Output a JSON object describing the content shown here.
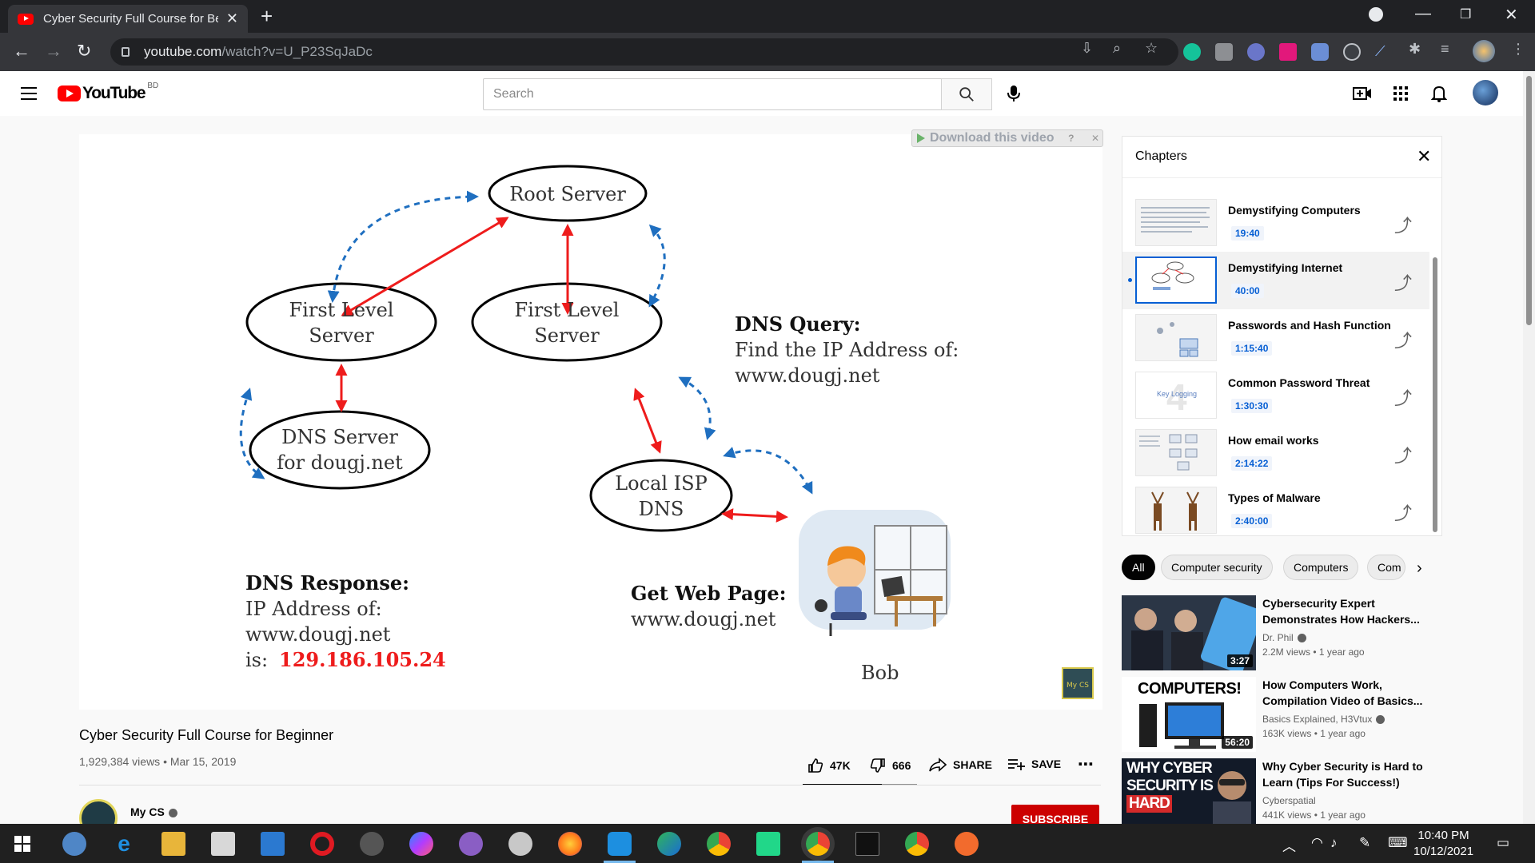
{
  "browser": {
    "tab_title": "Cyber Security Full Course for Be",
    "url_host": "youtube.com",
    "url_rest": "/watch?v=U_P23SqJaDc"
  },
  "youtube": {
    "logo_text": "YouTube",
    "country_code": "BD",
    "search_placeholder": "Search"
  },
  "video": {
    "download_label": "Download this video",
    "download_extra": "?",
    "title": "Cyber Security Full Course for Beginner",
    "meta": "1,929,384 views • Mar 15, 2019",
    "likes": "47K",
    "dislikes": "666",
    "share_label": "SHARE",
    "save_label": "SAVE",
    "like_ratio": 0.69,
    "channel": "My CS",
    "subscribe_label": "SUBSCRIBE"
  },
  "diagram": {
    "root": "Root Server",
    "first_level_1_line1": "First Level",
    "first_level_1_line2": "Server",
    "first_level_2_line1": "First Level",
    "first_level_2_line2": "Server",
    "dns_server_line1": "DNS Server",
    "dns_server_line2": "for dougj.net",
    "local_isp_line1": "Local ISP",
    "local_isp_line2": "DNS",
    "query_title": "DNS Query:",
    "query_line1": "Find the IP Address of:",
    "query_line2": "www.dougj.net",
    "response_title": "DNS Response:",
    "response_line1": "IP Address of:",
    "response_line2": "www.dougj.net",
    "response_is": "is:",
    "response_ip": "129.186.105.24",
    "webpage_title": "Get Web Page:",
    "webpage_line": "www.dougj.net",
    "user": "Bob",
    "watermark": "My CS"
  },
  "chapters": {
    "title": "Chapters",
    "items": [
      {
        "name": "Demystifying Computers",
        "time": "19:40"
      },
      {
        "name": "Demystifying Internet",
        "time": "40:00"
      },
      {
        "name": "Passwords and Hash Function",
        "time": "1:15:40"
      },
      {
        "name": "Common Password Threat",
        "time": "1:30:30"
      },
      {
        "name": "How email works",
        "time": "2:14:22"
      },
      {
        "name": "Types of Malware",
        "time": "2:40:00"
      }
    ],
    "thumb_text": "Key Logging"
  },
  "chips": [
    "All",
    "Computer security",
    "Computers",
    "Com"
  ],
  "recommendations": [
    {
      "title": "Cybersecurity Expert Demonstrates How Hackers...",
      "channel": "Dr. Phil",
      "views": "2.2M views • 1 year ago",
      "duration": "3:27",
      "thumb_text": ""
    },
    {
      "title": "How Computers Work, Compilation Video of Basics...",
      "channel": "Basics Explained, H3Vtux",
      "views": "163K views • 1 year ago",
      "duration": "56:20",
      "thumb_text": "COMPUTERS!"
    },
    {
      "title": "Why Cyber Security is Hard to Learn (Tips For Success!)",
      "channel": "Cyberspatial",
      "views": "441K views • 1 year ago",
      "duration": "",
      "thumb_text_1": "WHY CYBER",
      "thumb_text_2": "SECURITY IS",
      "thumb_text_3": "HARD"
    }
  ],
  "taskbar": {
    "time": "10:40 PM",
    "date": "10/12/2021"
  },
  "colors": {
    "youtube_red": "#ff0000",
    "link_blue": "#065fd4",
    "subscribe_red": "#cc0000",
    "diagram_red": "#ee1c1c",
    "diagram_blue": "#1f6fc0"
  }
}
